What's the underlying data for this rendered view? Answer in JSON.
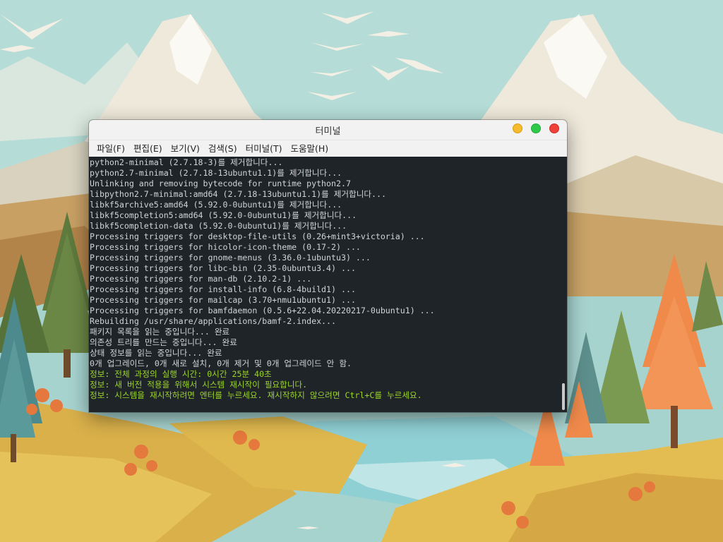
{
  "window": {
    "title": "터미널",
    "menu": [
      "파일(F)",
      "편집(E)",
      "보기(V)",
      "검색(S)",
      "터미널(T)",
      "도움말(H)"
    ]
  },
  "terminal": {
    "lines": [
      {
        "text": "python2-minimal (2.7.18-3)를 제거합니다...",
        "style": "normal"
      },
      {
        "text": "python2.7-minimal (2.7.18-13ubuntu1.1)를 제거합니다...",
        "style": "normal"
      },
      {
        "text": "Unlinking and removing bytecode for runtime python2.7",
        "style": "normal"
      },
      {
        "text": "libpython2.7-minimal:amd64 (2.7.18-13ubuntu1.1)를 제거합니다...",
        "style": "normal"
      },
      {
        "text": "libkf5archive5:amd64 (5.92.0-0ubuntu1)를 제거합니다...",
        "style": "normal"
      },
      {
        "text": "libkf5completion5:amd64 (5.92.0-0ubuntu1)를 제거합니다...",
        "style": "normal"
      },
      {
        "text": "libkf5completion-data (5.92.0-0ubuntu1)를 제거합니다...",
        "style": "normal"
      },
      {
        "text": "Processing triggers for desktop-file-utils (0.26+mint3+victoria) ...",
        "style": "normal"
      },
      {
        "text": "Processing triggers for hicolor-icon-theme (0.17-2) ...",
        "style": "normal"
      },
      {
        "text": "Processing triggers for gnome-menus (3.36.0-1ubuntu3) ...",
        "style": "normal"
      },
      {
        "text": "Processing triggers for libc-bin (2.35-0ubuntu3.4) ...",
        "style": "normal"
      },
      {
        "text": "Processing triggers for man-db (2.10.2-1) ...",
        "style": "normal"
      },
      {
        "text": "Processing triggers for install-info (6.8-4build1) ...",
        "style": "normal"
      },
      {
        "text": "Processing triggers for mailcap (3.70+nmu1ubuntu1) ...",
        "style": "normal"
      },
      {
        "text": "Processing triggers for bamfdaemon (0.5.6+22.04.20220217-0ubuntu1) ...",
        "style": "normal"
      },
      {
        "text": "Rebuilding /usr/share/applications/bamf-2.index...",
        "style": "normal"
      },
      {
        "text": "패키지 목록을 읽는 중입니다... 완료",
        "style": "normal"
      },
      {
        "text": "의존성 트리를 만드는 중입니다... 완료",
        "style": "normal"
      },
      {
        "text": "상태 정보를 읽는 중입니다... 완료",
        "style": "normal"
      },
      {
        "text": "0개 업그레이드, 0개 새로 설치, 0개 제거 및 0개 업그레이드 안 함.",
        "style": "normal"
      },
      {
        "text": "정보: 전체 과정의 실행 시간: 0시간 25분 40초",
        "style": "green"
      },
      {
        "text": "정보: 새 버전 적용을 위해서 시스템 재시작이 필요합니다.",
        "style": "green"
      },
      {
        "text": "정보: 시스템을 재시작하려면 엔터를 누르세요. 재시작하지 않으려면 Ctrl+C를 누르세요.",
        "style": "green"
      }
    ]
  },
  "colors": {
    "terminal_bg": "#1f2429",
    "terminal_fg": "#d2d4d6",
    "info_green": "#9dd62a",
    "btn_minimize": "#f4bb2c",
    "btn_maximize": "#2fc94a",
    "btn_close": "#f0403a"
  }
}
